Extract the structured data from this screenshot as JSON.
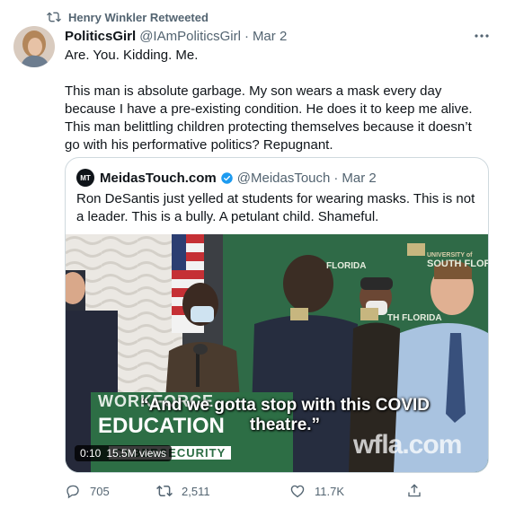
{
  "retweet": {
    "label": "Henry Winkler Retweeted",
    "icon": "retweet-icon"
  },
  "tweet": {
    "author_name": "PoliticsGirl",
    "author_handle": "@IAmPoliticsGirl",
    "separator": "·",
    "date": "Mar 2",
    "paragraph_1": "Are. You. Kidding. Me.",
    "paragraph_2": "This man is absolute garbage. My son wears a mask every day because I have a pre-existing condition. He does it to keep me alive. This man belittling children protecting themselves because it doesn’t go with his performative politics? Repugnant.",
    "more_icon": "more-options-icon"
  },
  "quoted_tweet": {
    "avatar_text": "MT",
    "author_name": "MeidasTouch.com",
    "author_handle": "@MeidasTouch",
    "separator": "·",
    "date": "Mar 2",
    "text": "Ron DeSantis just yelled at students for wearing masks. This is not a leader. This is a bully. A petulant child. Shameful.",
    "video": {
      "caption": "“And we gotta stop with this COVID theatre.”",
      "time": "0:10",
      "views": "15.5M views",
      "watermark": "wfla.com",
      "banner_line_1": "WORKFORCE",
      "banner_line_2": "EDUCATION",
      "banner_line_3": "CYBERSECURITY",
      "backdrop_text_1": "FLORIDA",
      "backdrop_text_2": "SOUTH FLORID",
      "backdrop_text_3": "TH FLORIDA",
      "backdrop_small": "UNIVERSITY of"
    }
  },
  "actions": {
    "reply_count": "705",
    "retweet_count": "2,511",
    "like_count": "11.7K"
  },
  "colors": {
    "text": "#0f1419",
    "secondary": "#536471",
    "verified": "#1d9bf0",
    "border": "#cfd9de"
  }
}
